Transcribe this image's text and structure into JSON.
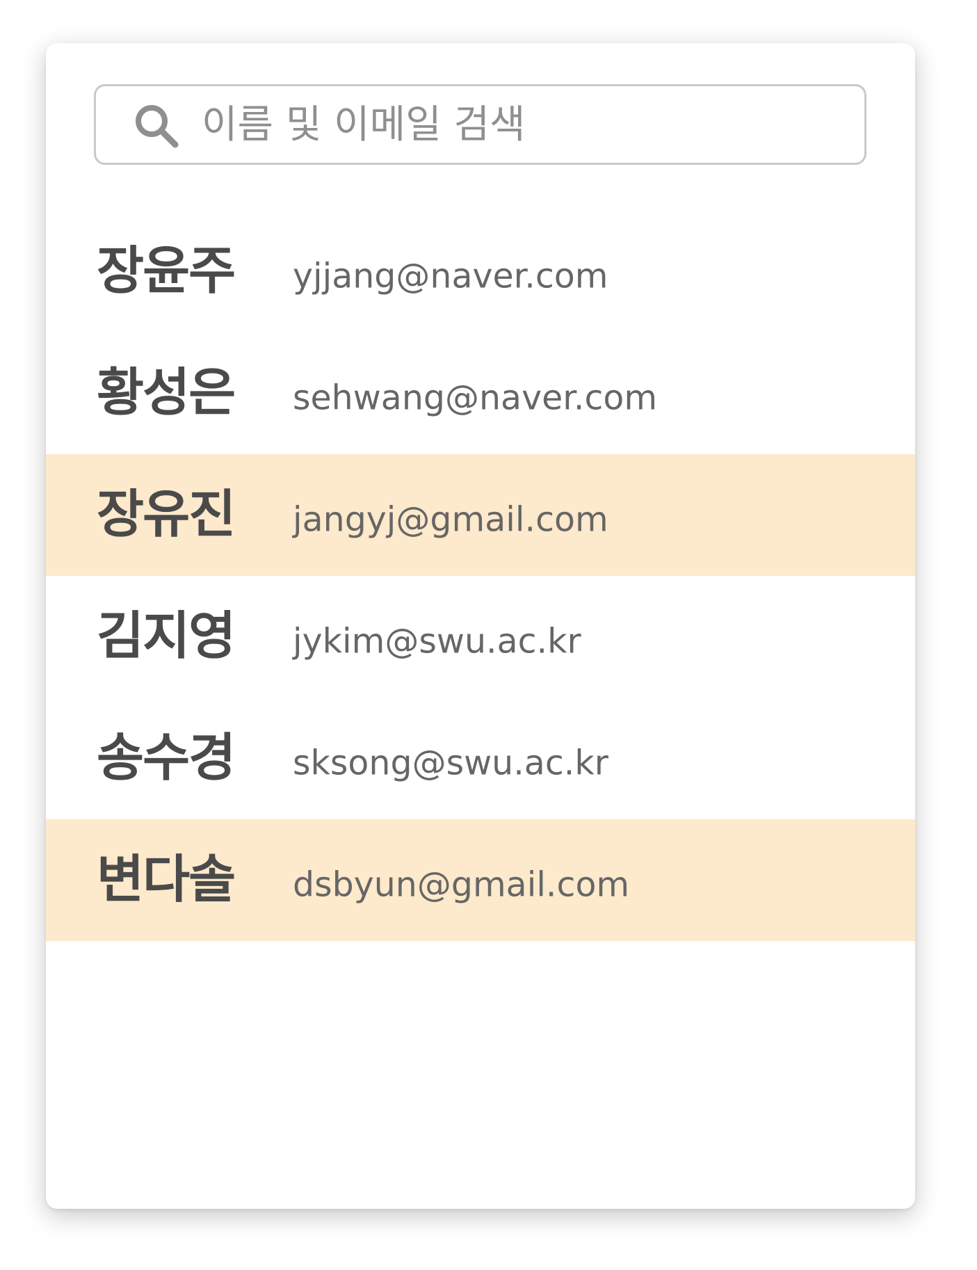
{
  "search": {
    "placeholder": "이름 및 이메일 검색",
    "value": ""
  },
  "contacts": [
    {
      "name": "장윤주",
      "email": "yjjang@naver.com",
      "highlighted": false
    },
    {
      "name": "황성은",
      "email": "sehwang@naver.com",
      "highlighted": false
    },
    {
      "name": "장유진",
      "email": "jangyj@gmail.com",
      "highlighted": true
    },
    {
      "name": "김지영",
      "email": "jykim@swu.ac.kr",
      "highlighted": false
    },
    {
      "name": "송수경",
      "email": "sksong@swu.ac.kr",
      "highlighted": false
    },
    {
      "name": "변다솔",
      "email": "dsbyun@gmail.com",
      "highlighted": true
    }
  ],
  "colors": {
    "highlight": "#fde9cb",
    "name_text": "#4a4a4a",
    "email_text": "#666666",
    "placeholder_text": "#8f8f8f",
    "border": "#c9c9c9"
  },
  "icons": {
    "search": "search-icon"
  }
}
